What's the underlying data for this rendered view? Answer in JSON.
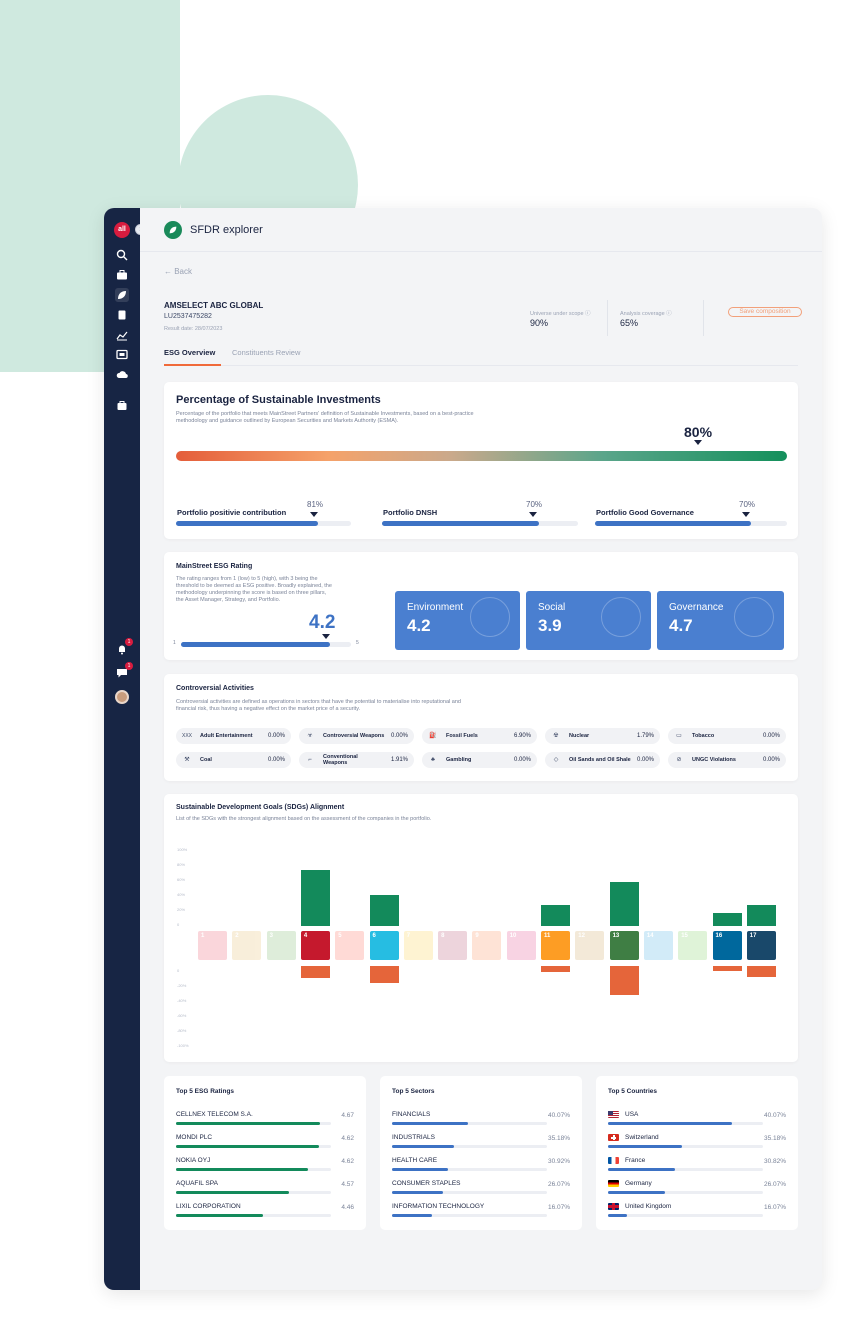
{
  "app": {
    "title": "SFDR explorer",
    "logo_text": "all"
  },
  "nav": {
    "back_label": "← Back"
  },
  "fund": {
    "name": "AMSELECT ABC GLOBAL",
    "isin": "LU2537475282",
    "result_date": "Result date: 28/07/2023",
    "universe_label": "Universe under scope ⓘ",
    "universe_value": "90%",
    "coverage_label": "Analysis coverage ⓘ",
    "coverage_value": "65%",
    "save_label": "Save composition"
  },
  "tabs": {
    "overview": "ESG Overview",
    "constituents": "Constituents Review"
  },
  "sustainable": {
    "title": "Percentage of Sustainable Investments",
    "desc_line1": "Percentage of the portfolio that meets MainStreet Partners' definition of Sustainable Investments, based on a best-practice",
    "desc_line2": "methodology and guidance outlined by European Securities and Markets Authority (ESMA).",
    "value": "80%",
    "value_fraction": 0.8,
    "subs": [
      {
        "label": "Portfolio positivie contribution",
        "value": "81%",
        "fraction": 0.81
      },
      {
        "label": "Portfolio DNSH",
        "value": "70%",
        "fraction": 0.8
      },
      {
        "label": "Portfolio Good Governance",
        "value": "70%",
        "fraction": 0.81
      }
    ]
  },
  "rating": {
    "title": "MainStreet ESG Rating",
    "desc": [
      "The rating ranges from 1 (low) to 5 (high), with 3 being the",
      "threshold to be deemed as ESG positive. Broadly explained, the",
      "methodology underpinning the score is based on three pillars,",
      "the Asset Manager, Strategy, and Portfolio."
    ],
    "value": "4.2",
    "min": "1",
    "max": "5",
    "pillars": [
      {
        "label": "Environment",
        "value": "4.2"
      },
      {
        "label": "Social",
        "value": "3.9"
      },
      {
        "label": "Governance",
        "value": "4.7"
      }
    ]
  },
  "controversial": {
    "title": "Controversial Activities",
    "desc_line1": "Controversial activities are defined as operations in sectors that have the potential to materialise into reputational and",
    "desc_line2": "financial risk, thus having a negative effect on the market price of a security.",
    "items": [
      {
        "icon": "XXX",
        "name": "Adult Entertainment",
        "value": "0.00%"
      },
      {
        "icon": "☣",
        "name": "Controversial Weapons",
        "value": "0.00%"
      },
      {
        "icon": "⛽",
        "name": "Fossil Fuels",
        "value": "6.90%"
      },
      {
        "icon": "☢",
        "name": "Nuclear",
        "value": "1.79%"
      },
      {
        "icon": "▭",
        "name": "Tobacco",
        "value": "0.00%"
      },
      {
        "icon": "⚒",
        "name": "Coal",
        "value": "0.00%"
      },
      {
        "icon": "⌐",
        "name": "Conventional Weapons",
        "value": "1.91%"
      },
      {
        "icon": "♣",
        "name": "Gambling",
        "value": "0.00%"
      },
      {
        "icon": "◇",
        "name": "Oil Sands and Oil Shale",
        "value": "0.00%"
      },
      {
        "icon": "⊘",
        "name": "UNGC Violations",
        "value": "0.00%"
      }
    ]
  },
  "sdg": {
    "title": "Sustainable Development Goals (SDGs) Alignment",
    "desc": "List of the SDGs with the strongest alignment based on the assessment of the companies in the portfolio.",
    "axis_top": [
      "100%",
      "80%",
      "60%",
      "40%",
      "20%",
      "0"
    ],
    "axis_bottom": [
      "0",
      "-20%",
      "-40%",
      "-60%",
      "-80%",
      "-100%"
    ]
  },
  "chart_data": {
    "type": "bar",
    "categories": [
      "1",
      "2",
      "3",
      "4",
      "5",
      "6",
      "7",
      "8",
      "9",
      "10",
      "11",
      "12",
      "13",
      "14",
      "15",
      "16",
      "17"
    ],
    "series": [
      {
        "values": [
          0,
          0,
          0,
          75,
          0,
          42,
          0,
          0,
          0,
          0,
          28,
          0,
          59,
          0,
          0,
          17,
          28
        ]
      },
      {
        "values": [
          0,
          0,
          0,
          -16,
          0,
          -22,
          0,
          0,
          0,
          0,
          -8,
          0,
          -38,
          0,
          0,
          -7,
          -14
        ]
      }
    ],
    "highlighted": [
      4,
      6,
      11,
      13,
      16,
      17
    ],
    "colors": {
      "positive": "#138a5b",
      "negative": "#e5653a"
    },
    "ylim": [
      -100,
      100
    ],
    "tile_colors": [
      "#e5243b",
      "#dda63a",
      "#4c9f38",
      "#c5192d",
      "#ff3a21",
      "#26bde2",
      "#fcc30b",
      "#a21942",
      "#fd6925",
      "#dd1367",
      "#fd9d24",
      "#bf8b2e",
      "#3f7e44",
      "#0a97d9",
      "#56c02b",
      "#00689d",
      "#19486a"
    ]
  },
  "top_ratings": {
    "title": "Top 5 ESG Ratings",
    "items": [
      {
        "name": "CELLNEX TELECOM S.A.",
        "value": "4.67",
        "fraction": 0.93
      },
      {
        "name": "MONDI PLC",
        "value": "4.62",
        "fraction": 0.92
      },
      {
        "name": "NOKIA OYJ",
        "value": "4.62",
        "fraction": 0.85
      },
      {
        "name": "AQUAFIL SPA",
        "value": "4.57",
        "fraction": 0.73
      },
      {
        "name": "LIXIL CORPORATION",
        "value": "4.46",
        "fraction": 0.56
      }
    ]
  },
  "top_sectors": {
    "title": "Top 5 Sectors",
    "items": [
      {
        "name": "FINANCIALS",
        "value": "40.07%",
        "fraction": 0.49
      },
      {
        "name": "INDUSTRIALS",
        "value": "35.18%",
        "fraction": 0.4
      },
      {
        "name": "HEALTH CARE",
        "value": "30.92%",
        "fraction": 0.36
      },
      {
        "name": "CONSUMER STAPLES",
        "value": "26.07%",
        "fraction": 0.33
      },
      {
        "name": "INFORMATION TECHNOLOGY",
        "value": "16.07%",
        "fraction": 0.26
      }
    ]
  },
  "top_countries": {
    "title": "Top 5 Countries",
    "items": [
      {
        "name": "USA",
        "value": "40.07%",
        "fraction": 0.8,
        "flag": "usa"
      },
      {
        "name": "Switzerland",
        "value": "35.18%",
        "fraction": 0.48
      },
      {
        "name": "France",
        "value": "30.82%",
        "fraction": 0.43
      },
      {
        "name": "Germany",
        "value": "26.07%",
        "fraction": 0.37
      },
      {
        "name": "United Kingdom",
        "value": "16.07%",
        "fraction": 0.12
      }
    ]
  }
}
